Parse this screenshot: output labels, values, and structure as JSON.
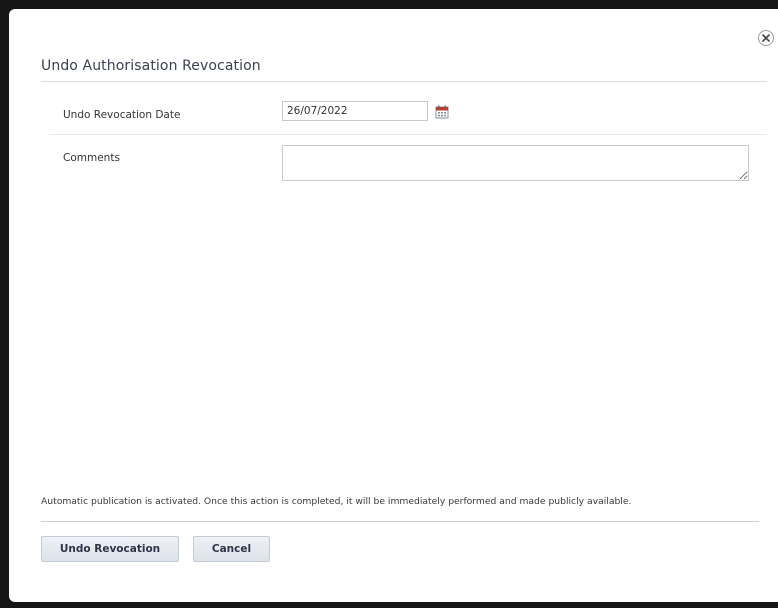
{
  "dialog": {
    "title": "Undo Authorisation Revocation",
    "close_icon": "close-icon"
  },
  "form": {
    "date_label": "Undo Revocation Date",
    "date_value": "26/07/2022",
    "calendar_icon": "calendar-icon",
    "comments_label": "Comments",
    "comments_value": ""
  },
  "notice": "Automatic publication is activated. Once this action is completed, it will be immediately performed and made publicly available.",
  "buttons": {
    "primary_label": "Undo Revocation",
    "cancel_label": "Cancel"
  },
  "colors": {
    "button_bg": "#e4e8ef",
    "button_text": "#2d3446",
    "calendar_accent": "#c0392b"
  }
}
